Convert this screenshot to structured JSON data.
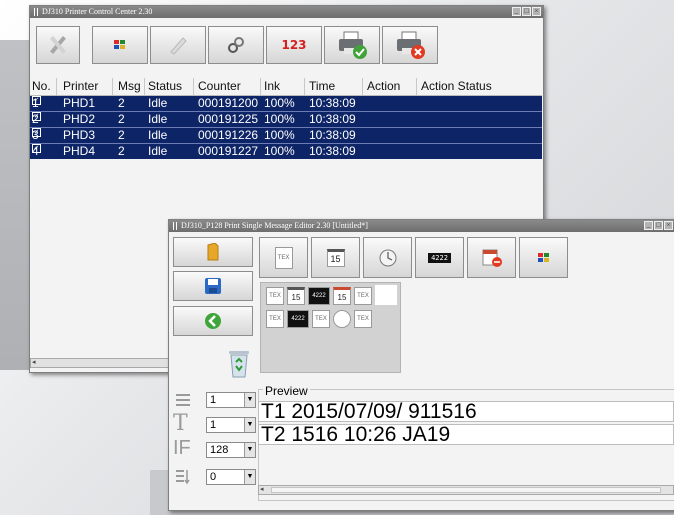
{
  "window1": {
    "title": "DJ310 Printer Control Center 2.30",
    "toolbar": {
      "counter_label": "123"
    },
    "columns": [
      "No.",
      "Printer",
      "Msg",
      "Status",
      "Counter",
      "Ink",
      "Time",
      "Action",
      "Action Status"
    ],
    "rows": [
      {
        "no": "1",
        "printer": "PHD1",
        "msg": "2",
        "status": "Idle",
        "counter": "000191200",
        "ink": "100%",
        "time": "10:38:09"
      },
      {
        "no": "2",
        "printer": "PHD2",
        "msg": "2",
        "status": "Idle",
        "counter": "000191225",
        "ink": "100%",
        "time": "10:38:09"
      },
      {
        "no": "3",
        "printer": "PHD3",
        "msg": "2",
        "status": "Idle",
        "counter": "000191226",
        "ink": "100%",
        "time": "10:38:09"
      },
      {
        "no": "4",
        "printer": "PHD4",
        "msg": "2",
        "status": "Idle",
        "counter": "000191227",
        "ink": "100%",
        "time": "10:38:09"
      }
    ],
    "row_selected_color": "#0d2466"
  },
  "window2": {
    "title": "DJ310_P128 Print Single Message Editor 2.30 [Untitled*]",
    "toolbar": {
      "date_num": "15",
      "counter_text": "4222"
    },
    "palette": {
      "text_icon": "TEX",
      "date_num": "15",
      "counter_text": "4222"
    },
    "fields": {
      "line": "1",
      "font": "1",
      "height": "128",
      "bold": "0"
    },
    "preview": {
      "label": "Preview",
      "line1": "T1 2015/07/09/ 911516",
      "line2": "T2 1516 10:26  JA19"
    }
  }
}
